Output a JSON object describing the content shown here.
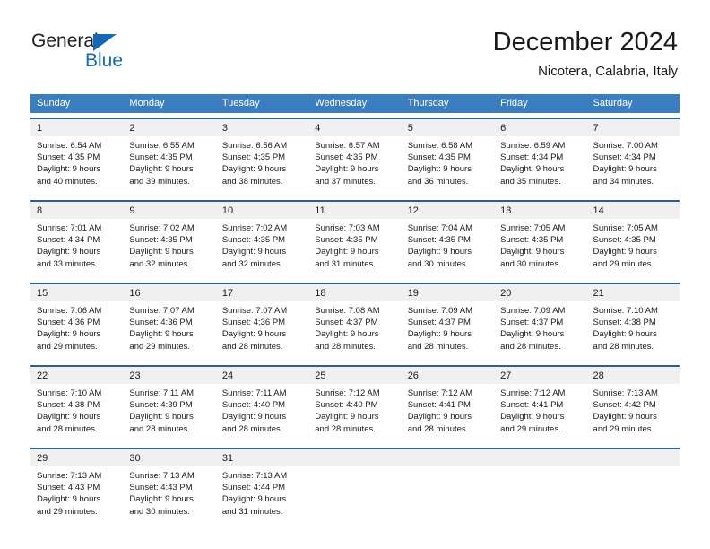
{
  "brand": {
    "name_part1": "General",
    "name_part2": "Blue",
    "logo_icon": "triangle-flag-icon",
    "color_primary": "#1668b3",
    "color_dark": "#231f20"
  },
  "header": {
    "title": "December 2024",
    "subtitle": "Nicotera, Calabria, Italy"
  },
  "theme": {
    "header_row_bg": "#3a7ebf",
    "cell_top_border": "#2a6099",
    "day_number_bg": "#f0f0f0",
    "text": "#1a1a1a"
  },
  "weekdays": [
    "Sunday",
    "Monday",
    "Tuesday",
    "Wednesday",
    "Thursday",
    "Friday",
    "Saturday"
  ],
  "labels": {
    "sunrise_prefix": "Sunrise:",
    "sunset_prefix": "Sunset:",
    "daylight_prefix": "Daylight:"
  },
  "weeks": [
    [
      {
        "day": "1",
        "line1": "Sunrise: 6:54 AM",
        "line2": "Sunset: 4:35 PM",
        "line3": "Daylight: 9 hours",
        "line4": "and 40 minutes."
      },
      {
        "day": "2",
        "line1": "Sunrise: 6:55 AM",
        "line2": "Sunset: 4:35 PM",
        "line3": "Daylight: 9 hours",
        "line4": "and 39 minutes."
      },
      {
        "day": "3",
        "line1": "Sunrise: 6:56 AM",
        "line2": "Sunset: 4:35 PM",
        "line3": "Daylight: 9 hours",
        "line4": "and 38 minutes."
      },
      {
        "day": "4",
        "line1": "Sunrise: 6:57 AM",
        "line2": "Sunset: 4:35 PM",
        "line3": "Daylight: 9 hours",
        "line4": "and 37 minutes."
      },
      {
        "day": "5",
        "line1": "Sunrise: 6:58 AM",
        "line2": "Sunset: 4:35 PM",
        "line3": "Daylight: 9 hours",
        "line4": "and 36 minutes."
      },
      {
        "day": "6",
        "line1": "Sunrise: 6:59 AM",
        "line2": "Sunset: 4:34 PM",
        "line3": "Daylight: 9 hours",
        "line4": "and 35 minutes."
      },
      {
        "day": "7",
        "line1": "Sunrise: 7:00 AM",
        "line2": "Sunset: 4:34 PM",
        "line3": "Daylight: 9 hours",
        "line4": "and 34 minutes."
      }
    ],
    [
      {
        "day": "8",
        "line1": "Sunrise: 7:01 AM",
        "line2": "Sunset: 4:34 PM",
        "line3": "Daylight: 9 hours",
        "line4": "and 33 minutes."
      },
      {
        "day": "9",
        "line1": "Sunrise: 7:02 AM",
        "line2": "Sunset: 4:35 PM",
        "line3": "Daylight: 9 hours",
        "line4": "and 32 minutes."
      },
      {
        "day": "10",
        "line1": "Sunrise: 7:02 AM",
        "line2": "Sunset: 4:35 PM",
        "line3": "Daylight: 9 hours",
        "line4": "and 32 minutes."
      },
      {
        "day": "11",
        "line1": "Sunrise: 7:03 AM",
        "line2": "Sunset: 4:35 PM",
        "line3": "Daylight: 9 hours",
        "line4": "and 31 minutes."
      },
      {
        "day": "12",
        "line1": "Sunrise: 7:04 AM",
        "line2": "Sunset: 4:35 PM",
        "line3": "Daylight: 9 hours",
        "line4": "and 30 minutes."
      },
      {
        "day": "13",
        "line1": "Sunrise: 7:05 AM",
        "line2": "Sunset: 4:35 PM",
        "line3": "Daylight: 9 hours",
        "line4": "and 30 minutes."
      },
      {
        "day": "14",
        "line1": "Sunrise: 7:05 AM",
        "line2": "Sunset: 4:35 PM",
        "line3": "Daylight: 9 hours",
        "line4": "and 29 minutes."
      }
    ],
    [
      {
        "day": "15",
        "line1": "Sunrise: 7:06 AM",
        "line2": "Sunset: 4:36 PM",
        "line3": "Daylight: 9 hours",
        "line4": "and 29 minutes."
      },
      {
        "day": "16",
        "line1": "Sunrise: 7:07 AM",
        "line2": "Sunset: 4:36 PM",
        "line3": "Daylight: 9 hours",
        "line4": "and 29 minutes."
      },
      {
        "day": "17",
        "line1": "Sunrise: 7:07 AM",
        "line2": "Sunset: 4:36 PM",
        "line3": "Daylight: 9 hours",
        "line4": "and 28 minutes."
      },
      {
        "day": "18",
        "line1": "Sunrise: 7:08 AM",
        "line2": "Sunset: 4:37 PM",
        "line3": "Daylight: 9 hours",
        "line4": "and 28 minutes."
      },
      {
        "day": "19",
        "line1": "Sunrise: 7:09 AM",
        "line2": "Sunset: 4:37 PM",
        "line3": "Daylight: 9 hours",
        "line4": "and 28 minutes."
      },
      {
        "day": "20",
        "line1": "Sunrise: 7:09 AM",
        "line2": "Sunset: 4:37 PM",
        "line3": "Daylight: 9 hours",
        "line4": "and 28 minutes."
      },
      {
        "day": "21",
        "line1": "Sunrise: 7:10 AM",
        "line2": "Sunset: 4:38 PM",
        "line3": "Daylight: 9 hours",
        "line4": "and 28 minutes."
      }
    ],
    [
      {
        "day": "22",
        "line1": "Sunrise: 7:10 AM",
        "line2": "Sunset: 4:38 PM",
        "line3": "Daylight: 9 hours",
        "line4": "and 28 minutes."
      },
      {
        "day": "23",
        "line1": "Sunrise: 7:11 AM",
        "line2": "Sunset: 4:39 PM",
        "line3": "Daylight: 9 hours",
        "line4": "and 28 minutes."
      },
      {
        "day": "24",
        "line1": "Sunrise: 7:11 AM",
        "line2": "Sunset: 4:40 PM",
        "line3": "Daylight: 9 hours",
        "line4": "and 28 minutes."
      },
      {
        "day": "25",
        "line1": "Sunrise: 7:12 AM",
        "line2": "Sunset: 4:40 PM",
        "line3": "Daylight: 9 hours",
        "line4": "and 28 minutes."
      },
      {
        "day": "26",
        "line1": "Sunrise: 7:12 AM",
        "line2": "Sunset: 4:41 PM",
        "line3": "Daylight: 9 hours",
        "line4": "and 28 minutes."
      },
      {
        "day": "27",
        "line1": "Sunrise: 7:12 AM",
        "line2": "Sunset: 4:41 PM",
        "line3": "Daylight: 9 hours",
        "line4": "and 29 minutes."
      },
      {
        "day": "28",
        "line1": "Sunrise: 7:13 AM",
        "line2": "Sunset: 4:42 PM",
        "line3": "Daylight: 9 hours",
        "line4": "and 29 minutes."
      }
    ],
    [
      {
        "day": "29",
        "line1": "Sunrise: 7:13 AM",
        "line2": "Sunset: 4:43 PM",
        "line3": "Daylight: 9 hours",
        "line4": "and 29 minutes."
      },
      {
        "day": "30",
        "line1": "Sunrise: 7:13 AM",
        "line2": "Sunset: 4:43 PM",
        "line3": "Daylight: 9 hours",
        "line4": "and 30 minutes."
      },
      {
        "day": "31",
        "line1": "Sunrise: 7:13 AM",
        "line2": "Sunset: 4:44 PM",
        "line3": "Daylight: 9 hours",
        "line4": "and 31 minutes."
      },
      {
        "day": "",
        "line1": "",
        "line2": "",
        "line3": "",
        "line4": ""
      },
      {
        "day": "",
        "line1": "",
        "line2": "",
        "line3": "",
        "line4": ""
      },
      {
        "day": "",
        "line1": "",
        "line2": "",
        "line3": "",
        "line4": ""
      },
      {
        "day": "",
        "line1": "",
        "line2": "",
        "line3": "",
        "line4": ""
      }
    ]
  ]
}
